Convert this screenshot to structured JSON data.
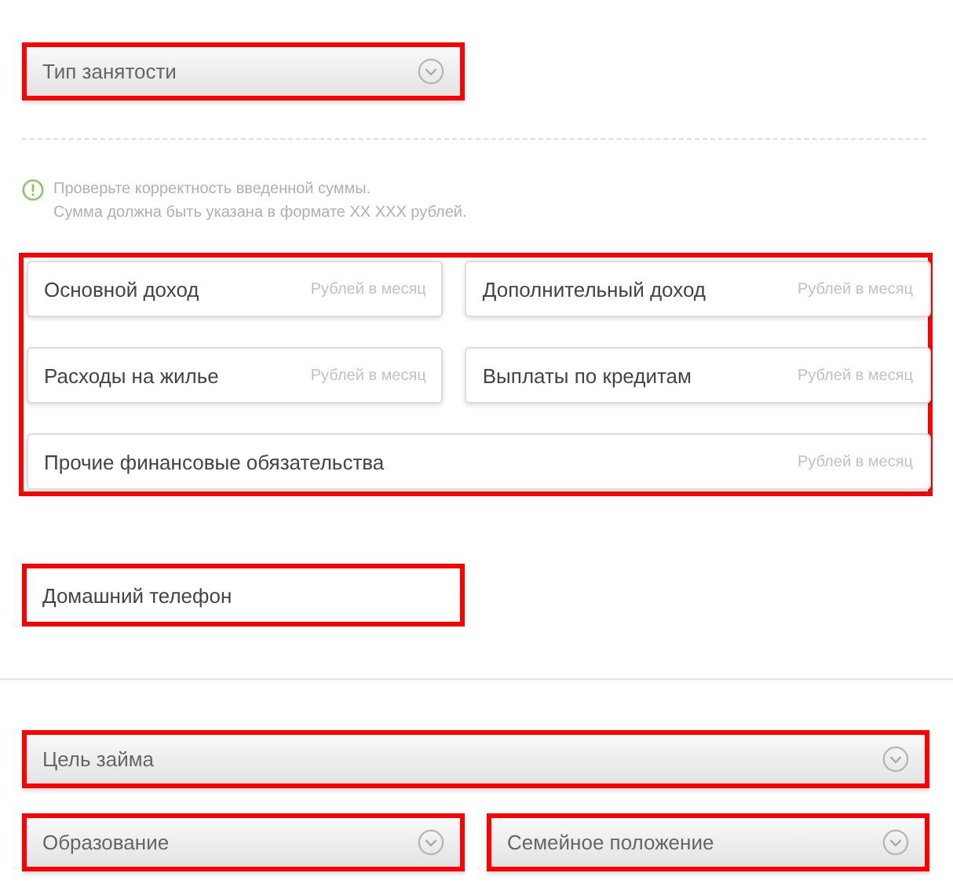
{
  "blocks": [
    {
      "kind": "fields",
      "items": [
        {
          "kind": "select",
          "label": "Тип занятости",
          "wide": false,
          "highlighted": true
        }
      ]
    },
    {
      "kind": "divider",
      "dashed": true
    },
    {
      "kind": "notice",
      "lines": [
        "Проверьте корректность введенной суммы.",
        "Сумма должна быть указана в формате XX XXX рублей."
      ]
    },
    {
      "kind": "fields",
      "highlighted": true,
      "items": [
        {
          "kind": "amount",
          "label": "Основной доход",
          "placeholder": "Рублей в месяц",
          "wide": false,
          "highlighted": false
        },
        {
          "kind": "amount",
          "label": "Дополнительный доход",
          "placeholder": "Рублей в месяц",
          "wide": false,
          "highlighted": false
        },
        {
          "kind": "amount",
          "label": "Расходы на жилье",
          "placeholder": "Рублей в месяц",
          "wide": false,
          "highlighted": false
        },
        {
          "kind": "amount",
          "label": "Выплаты по кредитам",
          "placeholder": "Рублей в месяц",
          "wide": false,
          "highlighted": false
        },
        {
          "kind": "amount",
          "label": "Прочие финансовые обязательства",
          "placeholder": "Рублей в месяц",
          "wide": true,
          "highlighted": false
        }
      ]
    },
    {
      "kind": "fields",
      "items": [
        {
          "kind": "text",
          "label": "Домашний телефон",
          "wide": false,
          "highlighted": true
        }
      ]
    },
    {
      "kind": "divider",
      "dashed": false
    },
    {
      "kind": "fields",
      "items": [
        {
          "kind": "select",
          "label": "Цель займа",
          "wide": true,
          "highlighted": true
        },
        {
          "kind": "select",
          "label": "Образование",
          "wide": false,
          "highlighted": true
        },
        {
          "kind": "select",
          "label": "Семейное положение",
          "wide": false,
          "highlighted": true
        }
      ]
    }
  ]
}
